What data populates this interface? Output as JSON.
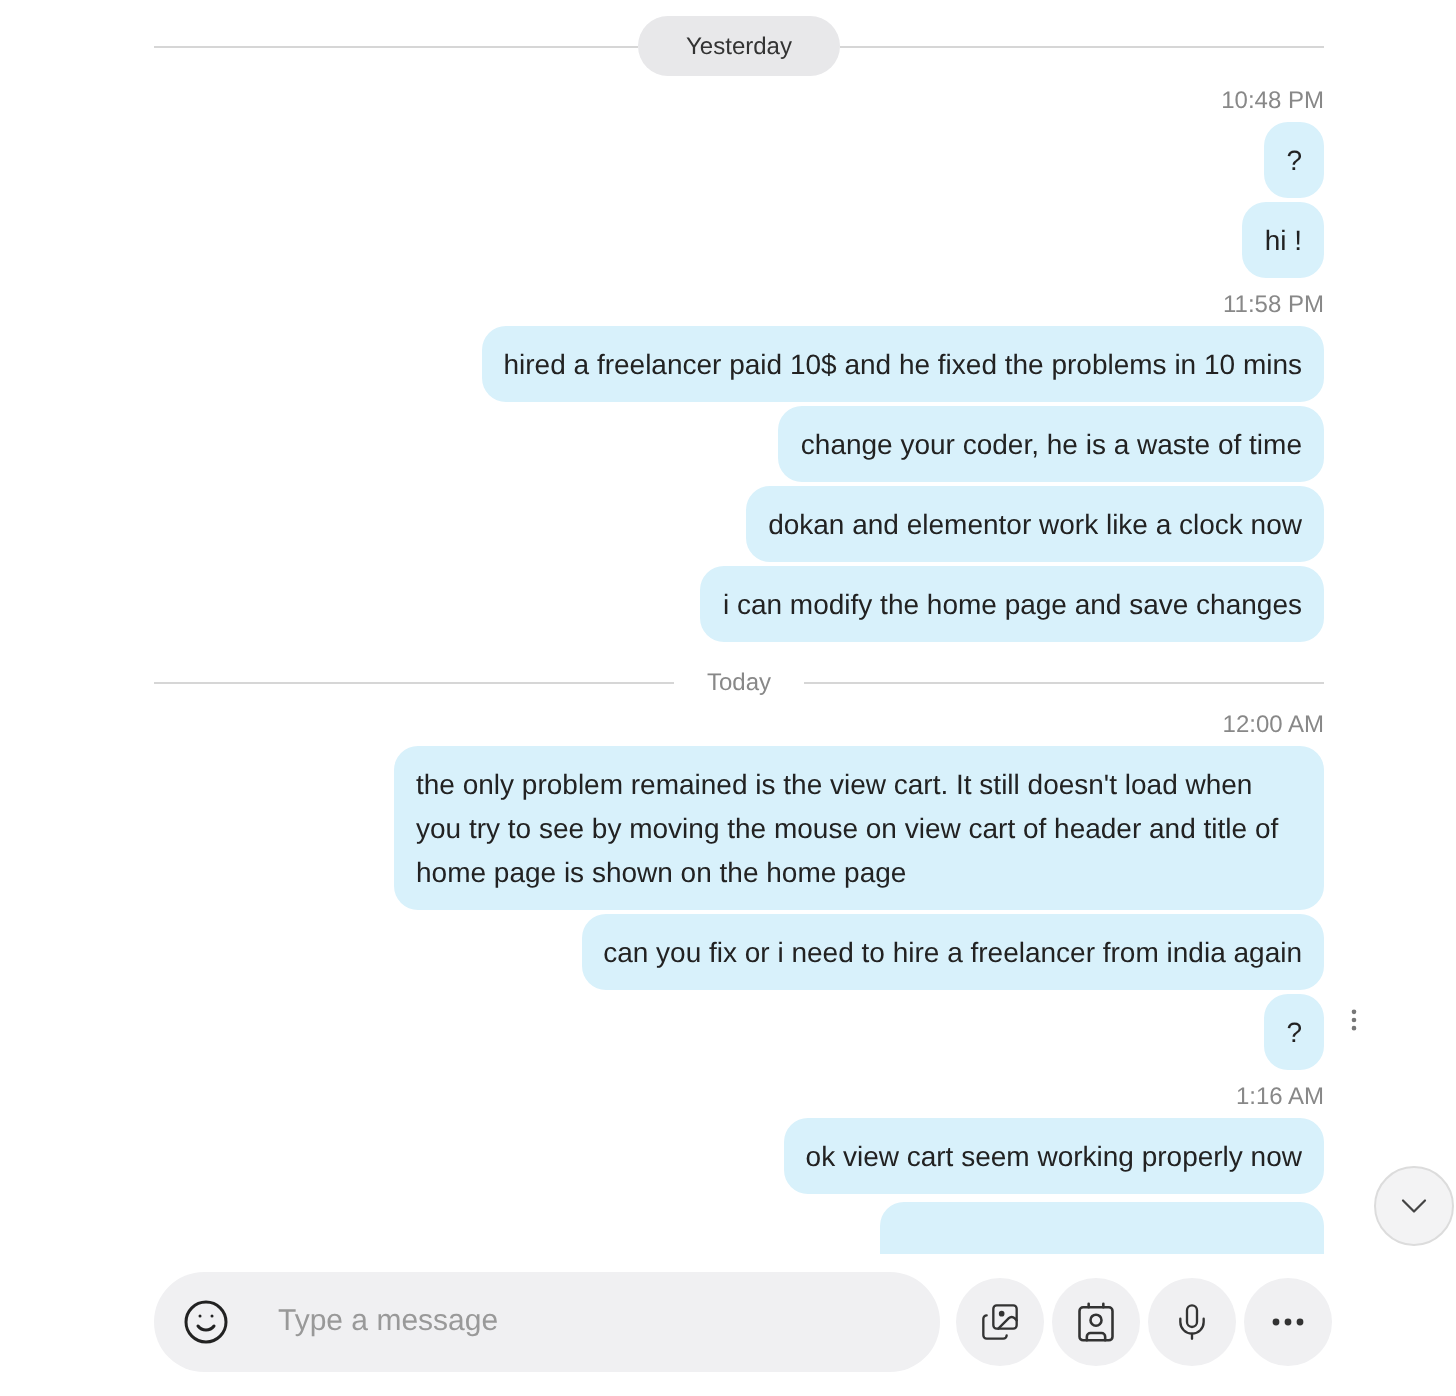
{
  "sections": [
    {
      "divider": "Yesterday",
      "kind": "pill",
      "groups": [
        {
          "time": "10:48 PM",
          "messages": [
            {
              "text": "?",
              "menu": false
            },
            {
              "text": "hi !",
              "menu": false
            }
          ]
        },
        {
          "time": "11:58 PM",
          "messages": [
            {
              "text": "hired a freelancer paid 10$ and he fixed the problems in 10 mins",
              "menu": false
            },
            {
              "text": "change your coder, he is a waste of time",
              "menu": false
            },
            {
              "text": "dokan and elementor work like a clock now",
              "menu": false
            },
            {
              "text": "i can modify the home page and save changes",
              "menu": false
            }
          ]
        }
      ]
    },
    {
      "divider": "Today",
      "kind": "plain",
      "groups": [
        {
          "time": "12:00 AM",
          "messages": [
            {
              "text": "the only problem remained is the view cart. It still doesn't load when you try to see  by moving the mouse on view cart of header and title of home page is shown on the home page",
              "menu": false
            },
            {
              "text": "can you fix or i need to hire a freelancer from india again",
              "menu": false
            },
            {
              "text": "?",
              "menu": true
            }
          ]
        },
        {
          "time": "1:16 AM",
          "messages": [
            {
              "text": "ok view cart seem working properly now",
              "menu": false
            }
          ]
        }
      ]
    }
  ],
  "composer": {
    "placeholder": "Type a message"
  }
}
